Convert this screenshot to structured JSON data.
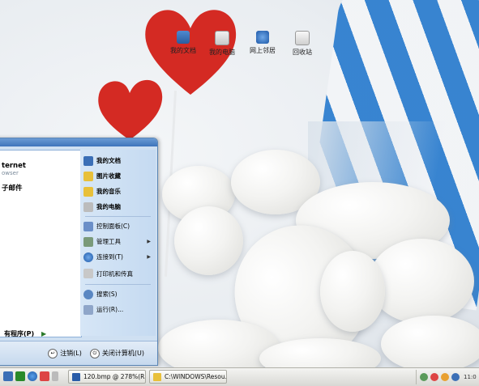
{
  "desktop_icons": [
    {
      "label": "我的文档",
      "icon": "folder-documents-icon"
    },
    {
      "label": "我的电脑",
      "icon": "computer-icon"
    },
    {
      "label": "网上邻居",
      "icon": "network-icon"
    },
    {
      "label": "回收站",
      "icon": "recycle-bin-icon"
    }
  ],
  "start_menu": {
    "left_items": [
      {
        "label": "ternet",
        "sub": "owser"
      },
      {
        "label": "子邮件",
        "sub": ""
      }
    ],
    "all_programs": "有程序(P)",
    "right_items": [
      {
        "label": "我的文档",
        "bold": true,
        "arrow": false
      },
      {
        "label": "图片收藏",
        "bold": true,
        "arrow": false
      },
      {
        "label": "我的音乐",
        "bold": true,
        "arrow": false
      },
      {
        "label": "我的电脑",
        "bold": true,
        "arrow": false
      },
      {
        "label": "控制面板(C)",
        "bold": false,
        "arrow": false
      },
      {
        "label": "管理工具",
        "bold": false,
        "arrow": true
      },
      {
        "label": "连接到(T)",
        "bold": false,
        "arrow": true
      },
      {
        "label": "打印机和传真",
        "bold": false,
        "arrow": false
      },
      {
        "label": "搜索(S)",
        "bold": false,
        "arrow": false
      },
      {
        "label": "运行(R)...",
        "bold": false,
        "arrow": false
      }
    ],
    "logoff": "注销(L)",
    "shutdown": "关闭计算机(U)"
  },
  "taskbar": {
    "buttons": [
      {
        "label": "120.bmp @ 278%(R...",
        "icon": "photoshop-icon"
      },
      {
        "label": "C:\\WINDOWS\\Resou...",
        "icon": "folder-icon"
      }
    ],
    "clock": "11:0"
  },
  "colors": {
    "accent": "#2f7fcf",
    "heart": "#d42a23"
  }
}
